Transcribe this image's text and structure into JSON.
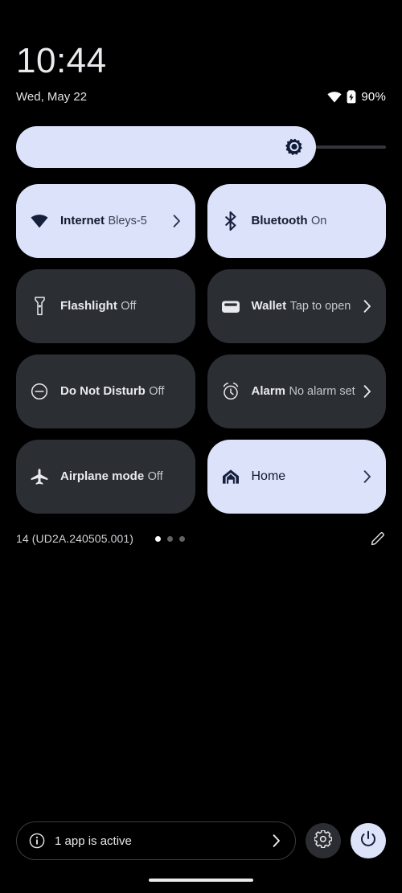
{
  "statusbar": {
    "time": "10:44",
    "date": "Wed, May 22",
    "battery_percent": "90%",
    "wifi_icon": "wifi-icon",
    "battery_icon": "battery-charging-icon"
  },
  "brightness": {
    "icon": "brightness-icon",
    "level_percent": 86
  },
  "tiles": [
    {
      "name": "internet",
      "label": "Internet",
      "sub": "Bleys-5",
      "icon": "wifi-icon",
      "state": "active",
      "chevron": true
    },
    {
      "name": "bluetooth",
      "label": "Bluetooth",
      "sub": "On",
      "icon": "bluetooth-icon",
      "state": "active",
      "chevron": false
    },
    {
      "name": "flashlight",
      "label": "Flashlight",
      "sub": "Off",
      "icon": "flashlight-icon",
      "state": "inactive",
      "chevron": false
    },
    {
      "name": "wallet",
      "label": "Wallet",
      "sub": "Tap to open",
      "icon": "wallet-icon",
      "state": "inactive",
      "chevron": true
    },
    {
      "name": "do-not-disturb",
      "label": "Do Not Disturb",
      "sub": "Off",
      "icon": "do-not-disturb-icon",
      "state": "inactive",
      "chevron": false
    },
    {
      "name": "alarm",
      "label": "Alarm",
      "sub": "No alarm set",
      "icon": "alarm-icon",
      "state": "inactive",
      "chevron": true
    },
    {
      "name": "airplane-mode",
      "label": "Airplane mode",
      "sub": "Off",
      "icon": "airplane-icon",
      "state": "inactive",
      "chevron": false
    },
    {
      "name": "home",
      "label": "Home",
      "sub": "",
      "icon": "home-icon",
      "state": "active",
      "chevron": true
    }
  ],
  "footer": {
    "build": "14 (UD2A.240505.001)",
    "pages": 3,
    "active_page": 1,
    "edit_icon": "pencil-edit-icon"
  },
  "bottombar": {
    "apps_active_text": "1 app is active",
    "info_icon": "info-icon",
    "chevron_icon": "chevron-right-icon",
    "settings_icon": "gear-icon",
    "power_icon": "power-icon"
  },
  "colors": {
    "background": "#000000",
    "tile_active": "#dce2f9",
    "tile_inactive": "#2b2e33",
    "accent_dark": "#121a2e",
    "text_primary": "#e8eaed",
    "text_secondary": "#c4c7cd"
  }
}
